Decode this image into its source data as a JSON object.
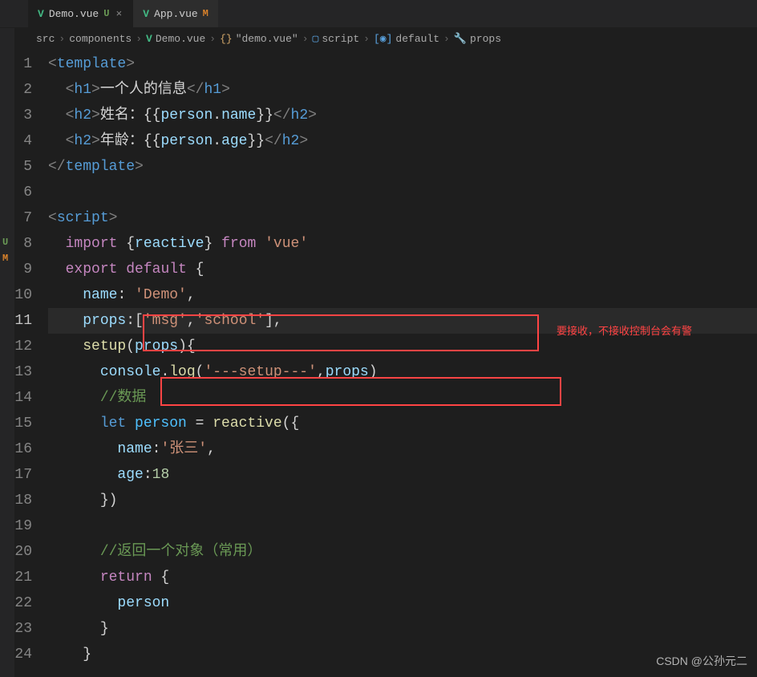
{
  "tabs": [
    {
      "icon": "V",
      "name": "Demo.vue",
      "badge": "U",
      "active": true,
      "closable": true
    },
    {
      "icon": "V",
      "name": "App.vue",
      "badge": "M",
      "active": false,
      "closable": false
    }
  ],
  "breadcrumb": [
    {
      "icon": "",
      "label": "src"
    },
    {
      "icon": "",
      "label": "components"
    },
    {
      "icon": "V",
      "label": "Demo.vue"
    },
    {
      "icon": "{}",
      "label": "\"demo.vue\""
    },
    {
      "icon": "▢",
      "label": "script"
    },
    {
      "icon": "[◉]",
      "label": "default"
    },
    {
      "icon": "🔧",
      "label": "props"
    }
  ],
  "lineNumbers": [
    "1",
    "2",
    "3",
    "4",
    "5",
    "6",
    "7",
    "8",
    "9",
    "10",
    "11",
    "12",
    "13",
    "14",
    "15",
    "16",
    "17",
    "18",
    "19",
    "20",
    "21",
    "22",
    "23",
    "24"
  ],
  "currentLine": 11,
  "code": {
    "l1": {
      "open": "<",
      "tag": "template",
      "close": ">"
    },
    "l2": {
      "open": "<",
      "tag": "h1",
      "close": ">",
      "text": "一个人的信息",
      "endopen": "</",
      "endclose": ">"
    },
    "l3": {
      "open": "<",
      "tag": "h2",
      "close": ">",
      "label": "姓名：",
      "bopen": "{{",
      "obj": "person",
      "dot": ".",
      "prop": "name",
      "bclose": "}}",
      "endopen": "</",
      "endclose": ">"
    },
    "l4": {
      "open": "<",
      "tag": "h2",
      "close": ">",
      "label": "年龄：",
      "bopen": "{{",
      "obj": "person",
      "dot": ".",
      "prop": "age",
      "bclose": "}}",
      "endopen": "</",
      "endclose": ">"
    },
    "l5": {
      "open": "</",
      "tag": "template",
      "close": ">"
    },
    "l7": {
      "open": "<",
      "tag": "script",
      "close": ">"
    },
    "l8": {
      "import": "import",
      "br": "{",
      "reactive": "reactive",
      "brc": "}",
      "from": "from",
      "vue": "'vue'"
    },
    "l9": {
      "export": "export",
      "default": "default",
      "br": "{"
    },
    "l10": {
      "name": "name",
      "colon": ": ",
      "val": "'Demo'",
      "comma": ","
    },
    "l11": {
      "props": "props",
      "colon": ":",
      "br": "[",
      "s1": "'msg'",
      "comma": ",",
      "s2": "'school'",
      "brc": "]",
      "end": ","
    },
    "l12": {
      "setup": "setup",
      "po": "(",
      "arg": "props",
      "pc": "){",
      "end": ""
    },
    "l13": {
      "console": "console",
      "dot": ".",
      "log": "log",
      "po": "(",
      "s": "'---setup---'",
      "comma": ",",
      "arg": "props",
      "pc": ")"
    },
    "l14": {
      "comment": "//数据"
    },
    "l15": {
      "let": "let",
      "person": "person",
      "eq": " = ",
      "reactive": "reactive",
      "po": "({"
    },
    "l16": {
      "name": "name",
      "colon": ":",
      "val": "'张三'",
      "comma": ","
    },
    "l17": {
      "age": "age",
      "colon": ":",
      "val": "18"
    },
    "l18": {
      "close": "})"
    },
    "l20": {
      "comment": "//返回一个对象（常用）"
    },
    "l21": {
      "return": "return",
      "br": " {"
    },
    "l22": {
      "person": "person"
    },
    "l23": {
      "close": "}"
    },
    "l24": {
      "close": "}"
    }
  },
  "annotation": "要接收，不接收控制台会有警",
  "watermark": "CSDN @公孙元二",
  "leftBadges": [
    "U",
    "M"
  ],
  "chart_data": null
}
